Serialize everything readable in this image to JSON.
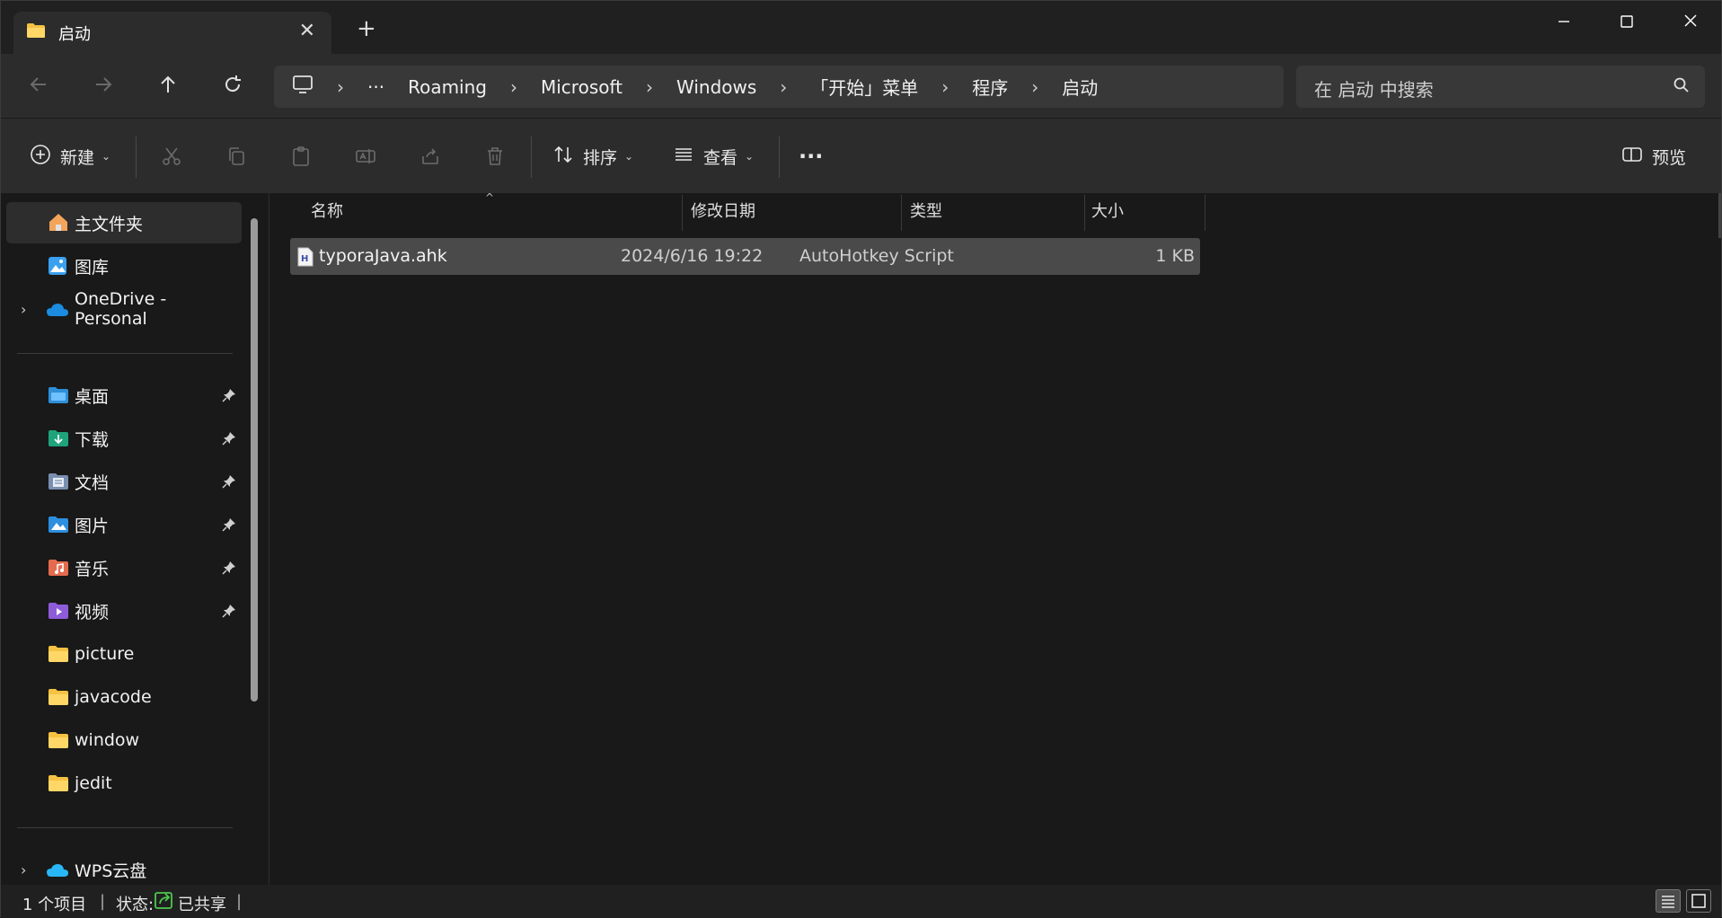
{
  "window": {
    "tab_title": "启动",
    "tab_close": "✕",
    "new_tab": "+",
    "minimize": "—",
    "maximize": "☐",
    "close": "✕"
  },
  "address": {
    "overflow": "···",
    "breadcrumbs": [
      "Roaming",
      "Microsoft",
      "Windows",
      "「开始」菜单",
      "程序",
      "启动"
    ],
    "separator": "›"
  },
  "search": {
    "placeholder": "在 启动 中搜索"
  },
  "toolbar": {
    "new_label": "新建",
    "sort_label": "排序",
    "view_label": "查看",
    "more": "···",
    "preview_label": "预览"
  },
  "sidebar": {
    "home": "主文件夹",
    "gallery": "图库",
    "onedrive": "OneDrive - Personal",
    "quick_access": [
      {
        "label": "桌面",
        "icon": "desktop-folder-icon",
        "pinned": true
      },
      {
        "label": "下载",
        "icon": "downloads-folder-icon",
        "pinned": true
      },
      {
        "label": "文档",
        "icon": "documents-folder-icon",
        "pinned": true
      },
      {
        "label": "图片",
        "icon": "pictures-folder-icon",
        "pinned": true
      },
      {
        "label": "音乐",
        "icon": "music-folder-icon",
        "pinned": true
      },
      {
        "label": "视频",
        "icon": "videos-folder-icon",
        "pinned": true
      },
      {
        "label": "picture",
        "icon": "folder-icon",
        "pinned": false
      },
      {
        "label": "javacode",
        "icon": "folder-icon",
        "pinned": false
      },
      {
        "label": "window",
        "icon": "folder-icon",
        "pinned": false
      },
      {
        "label": "jedit",
        "icon": "folder-icon",
        "pinned": false
      }
    ],
    "wps": "WPS云盘"
  },
  "columns": {
    "name": "名称",
    "modified": "修改日期",
    "type": "类型",
    "size": "大小"
  },
  "files": [
    {
      "name": "typoraJava.ahk",
      "modified": "2024/6/16 19:22",
      "type": "AutoHotkey Script",
      "size": "1 KB",
      "selected": true
    }
  ],
  "status": {
    "count": "1 个项目",
    "state_label": "状态:",
    "shared": "已共享"
  },
  "colors": {
    "background": "#191919",
    "chrome": "#2c2c2c",
    "selection": "#4a4a4a",
    "folder_yellow": "#f5c243",
    "accent_blue": "#3aa0f0"
  }
}
